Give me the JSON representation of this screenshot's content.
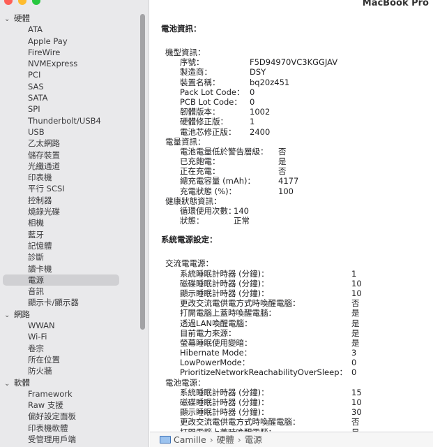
{
  "window": {
    "title": "MacBook Pro"
  },
  "sidebar": {
    "categories": [
      {
        "label": "硬體",
        "expanded": true,
        "items": [
          "ATA",
          "Apple Pay",
          "FireWire",
          "NVMExpress",
          "PCI",
          "SAS",
          "SATA",
          "SPI",
          "Thunderbolt/USB4",
          "USB",
          "乙太網路",
          "儲存裝置",
          "光纖通道",
          "印表機",
          "平行 SCSI",
          "控制器",
          "燒錄光碟",
          "相機",
          "藍牙",
          "記憶體",
          "診斷",
          "讀卡機",
          "電源",
          "音訊",
          "顯示卡/顯示器"
        ]
      },
      {
        "label": "網路",
        "expanded": true,
        "items": [
          "WWAN",
          "Wi-Fi",
          "卷宗",
          "所在位置",
          "防火牆"
        ]
      },
      {
        "label": "軟體",
        "expanded": true,
        "items": [
          "Framework",
          "Raw 支援",
          "偏好設定面板",
          "印表機軟體",
          "受管理用戶端"
        ]
      }
    ],
    "selected_item": "電源"
  },
  "battery": {
    "title": "電池資訊：",
    "model_header": "機型資訊：",
    "model": [
      {
        "k": "序號：",
        "v": "F5D94970VC3KGGJAV"
      },
      {
        "k": "製造商：",
        "v": "DSY"
      },
      {
        "k": "裝置名稱：",
        "v": "bq20z451"
      },
      {
        "k": "Pack Lot Code：",
        "v": "0"
      },
      {
        "k": "PCB Lot Code：",
        "v": "0"
      },
      {
        "k": "韌體版本：",
        "v": "1002"
      },
      {
        "k": "硬體修正版：",
        "v": "1"
      },
      {
        "k": "電池芯修正版：",
        "v": "2400"
      }
    ],
    "charge_header": "電量資訊：",
    "charge": [
      {
        "k": "電池電量低於警告層級：",
        "v": "否"
      },
      {
        "k": "已充飽電：",
        "v": "是"
      },
      {
        "k": "正在充電：",
        "v": "否"
      },
      {
        "k": "總充電容量 (mAh)：",
        "v": "4177"
      },
      {
        "k": "充電狀態 (%)：",
        "v": "100"
      }
    ],
    "health_header": "健康狀態資訊：",
    "health": [
      {
        "k": "循環使用次數：",
        "v": "140"
      },
      {
        "k": "狀態：",
        "v": "正常"
      }
    ]
  },
  "power": {
    "title": "系統電源設定：",
    "ac_header": "交流電電源：",
    "ac": [
      {
        "k": "系統睡眠計時器 (分鐘)：",
        "v": "1"
      },
      {
        "k": "磁碟睡眠計時器 (分鐘)：",
        "v": "10"
      },
      {
        "k": "顯示睡眠計時器 (分鐘)：",
        "v": "10"
      },
      {
        "k": "更改交流電供電方式時喚醒電腦：",
        "v": "否"
      },
      {
        "k": "打開電腦上蓋時喚醒電腦：",
        "v": "是"
      },
      {
        "k": "透過LAN喚醒電腦：",
        "v": "是"
      },
      {
        "k": "目前電力來源：",
        "v": "是"
      },
      {
        "k": "螢幕睡眠使用變暗：",
        "v": "是"
      },
      {
        "k": "Hibernate Mode：",
        "v": "3"
      },
      {
        "k": "LowPowerMode：",
        "v": "0"
      },
      {
        "k": "PrioritizeNetworkReachabilityOverSleep：",
        "v": "0"
      }
    ],
    "battery_header": "電池電源：",
    "battery": [
      {
        "k": "系統睡眠計時器 (分鐘)：",
        "v": "15"
      },
      {
        "k": "磁碟睡眠計時器 (分鐘)：",
        "v": "10"
      },
      {
        "k": "顯示睡眠計時器 (分鐘)：",
        "v": "30"
      },
      {
        "k": "更改交流電供電方式時喚醒電腦：",
        "v": "否"
      },
      {
        "k": "打開電腦上蓋時喚醒電腦：",
        "v": "是"
      }
    ]
  },
  "breadcrumb": {
    "computer": "Camille",
    "sep": "›",
    "section": "硬體",
    "item": "電源"
  }
}
